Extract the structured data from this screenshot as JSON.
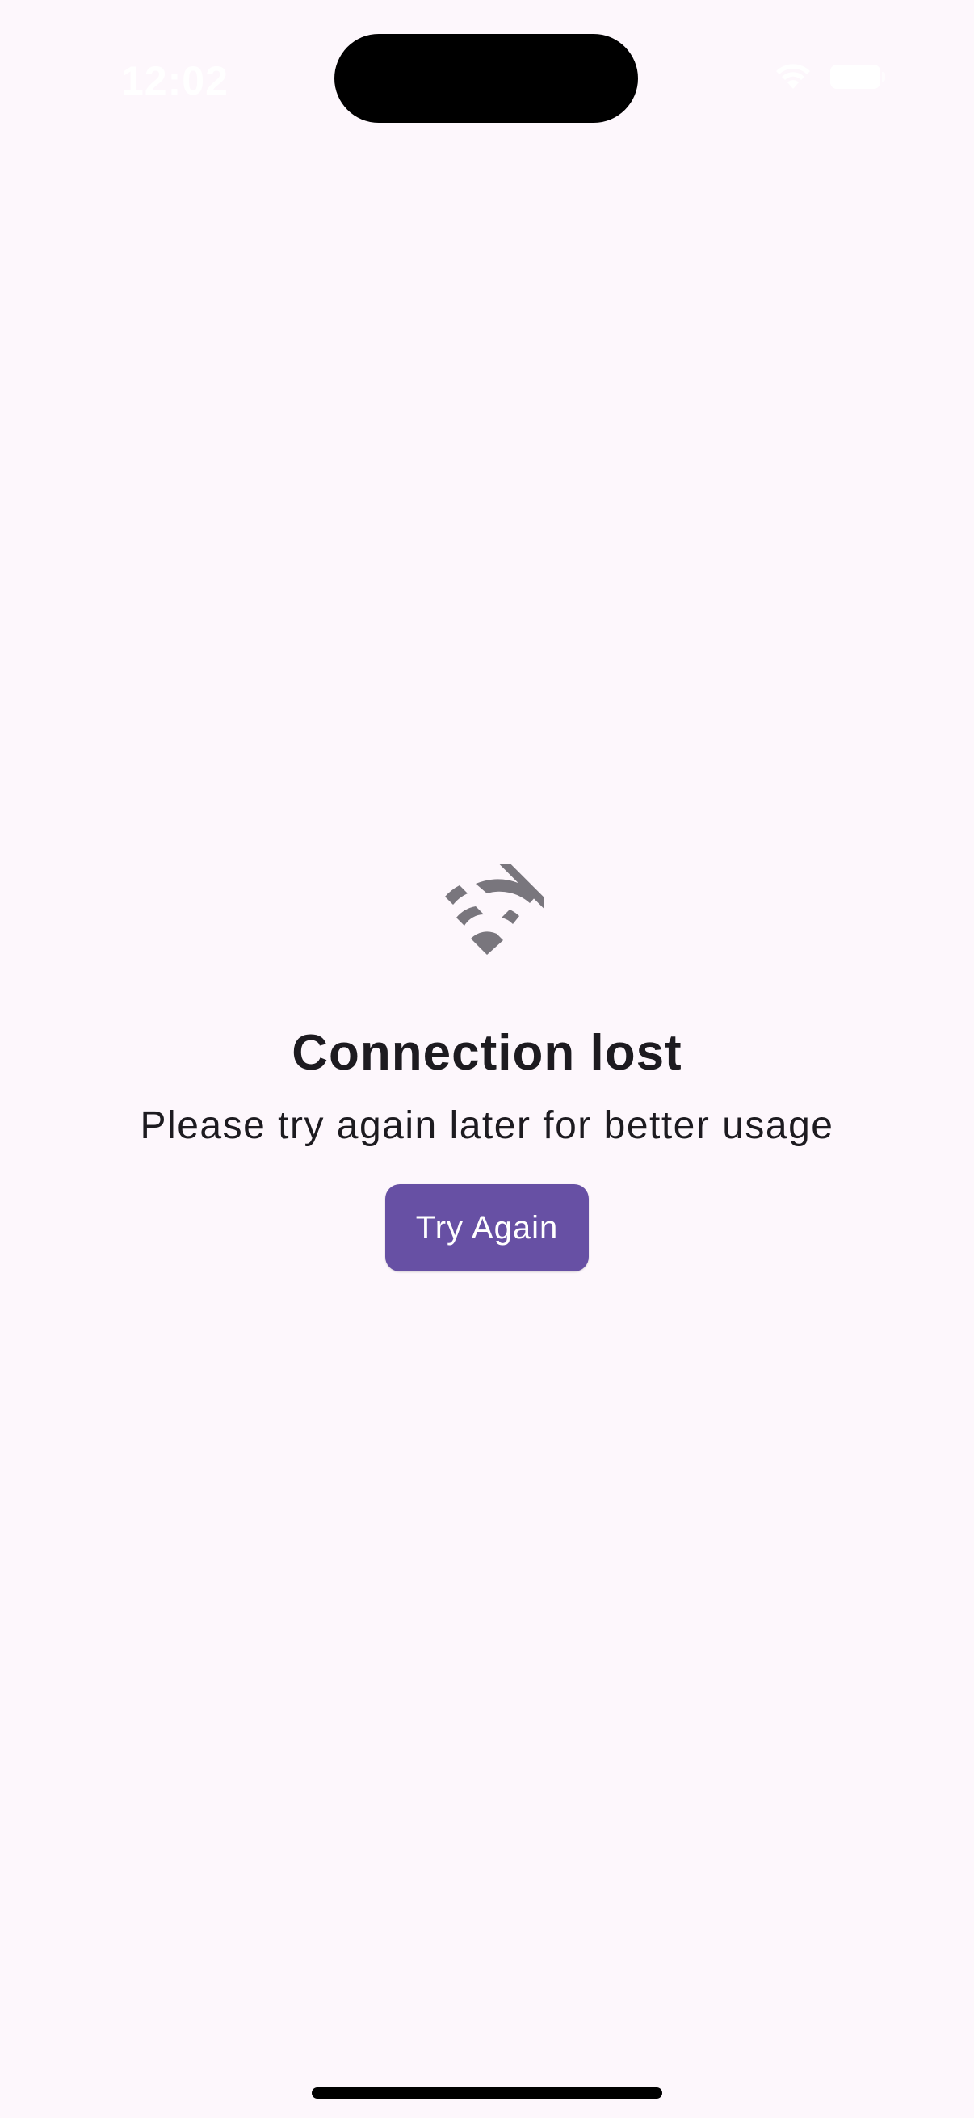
{
  "status_bar": {
    "time": "12:02",
    "icons": [
      "wifi-icon",
      "battery-icon"
    ]
  },
  "error": {
    "icon": "wifi-off-icon",
    "title": "Connection lost",
    "message": "Please try again later for better usage",
    "retry_label": "Try Again"
  },
  "colors": {
    "background": "#FDF7FC",
    "primary": "#6750A4",
    "text": "#1D1B20",
    "icon": "#79767D"
  }
}
